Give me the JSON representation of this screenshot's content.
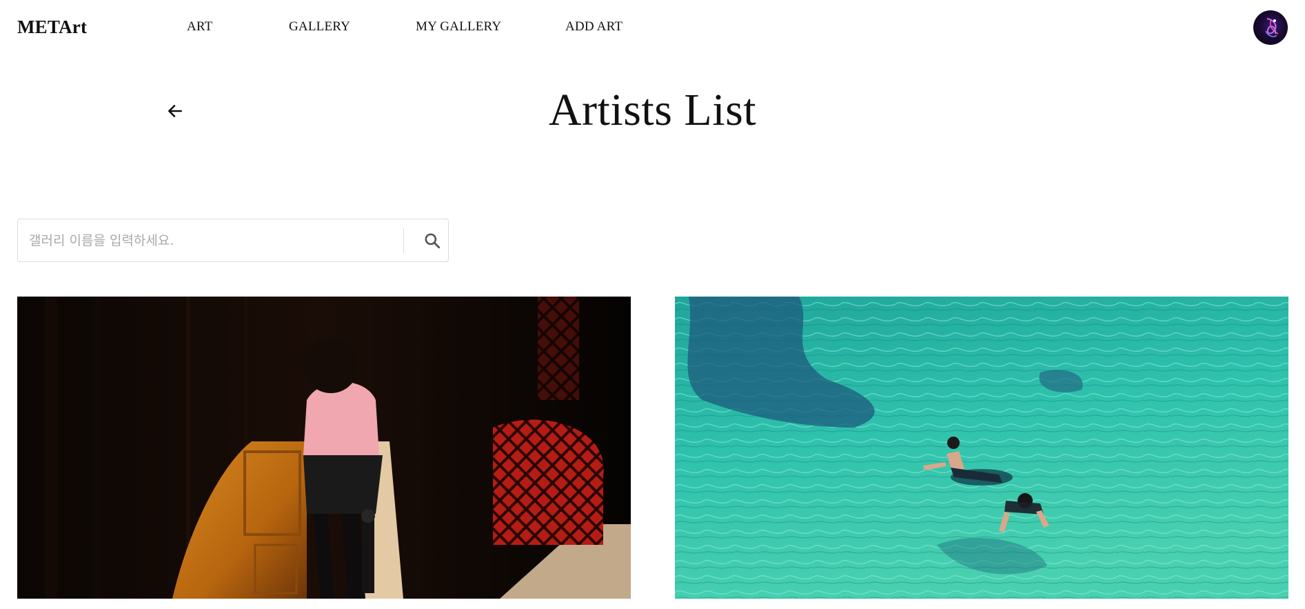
{
  "header": {
    "logo": "METArt",
    "nav": [
      {
        "label": "ART"
      },
      {
        "label": "GALLERY"
      },
      {
        "label": "MY GALLERY"
      },
      {
        "label": "ADD ART"
      }
    ],
    "avatar_icon": "user-avatar"
  },
  "page": {
    "title": "Artists List",
    "back_icon": "arrow-left-icon"
  },
  "search": {
    "placeholder": "갤러리 이름을 입력하세요.",
    "value": "",
    "icon": "search-icon"
  },
  "artworks": [
    {
      "image": "woman-in-doorway-light-and-shadow-photo"
    },
    {
      "image": "swimmers-in-turquoise-sea-photo"
    }
  ],
  "colors": {
    "text": "#111111",
    "border": "#dcdcdc",
    "placeholder": "#a9a9a9",
    "sea": "#2fb8a5"
  }
}
